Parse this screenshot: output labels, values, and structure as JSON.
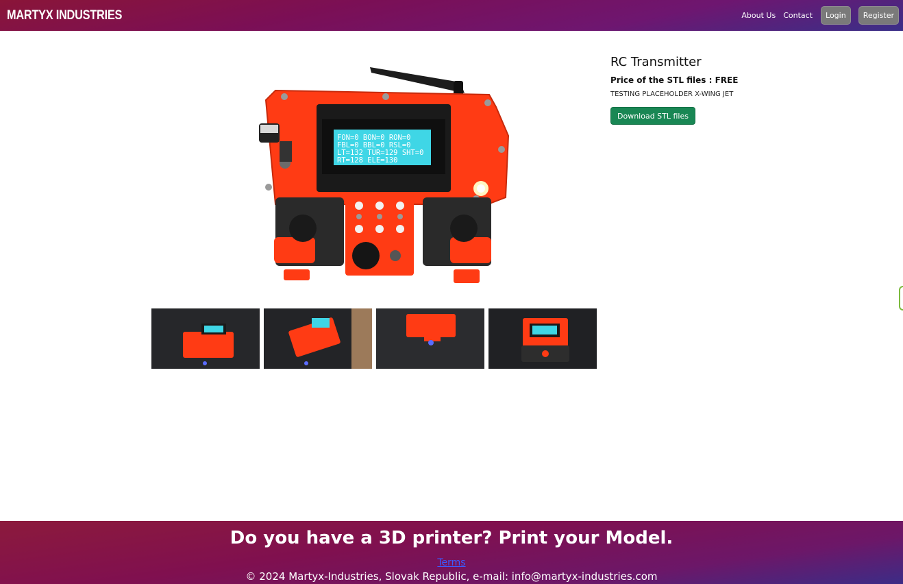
{
  "navbar": {
    "brand": "Martyx Industries",
    "links": {
      "about": "About Us",
      "contact": "Contact"
    },
    "buttons": {
      "login": "Login",
      "register": "Register"
    }
  },
  "product": {
    "title": "RC Transmitter",
    "price_line": "Price of the STL files : FREE",
    "description": "TESTING PLACEHOLDER X-WING JET",
    "download_label": "Download STL files",
    "lcd_lines": [
      "FON=0  BON=0  RON=0",
      "FBL=0  BBL=0  RSL=0",
      "LT=132 TUR=129 SHT=0",
      "RT=128 ELE=130"
    ],
    "accent_color": "#ff3b14",
    "thumbnail_count": 4
  },
  "footer": {
    "headline": "Do you have a 3D printer? Print your Model.",
    "terms_link": "Terms",
    "copyright": "© 2024 Martyx-Industries, Slovak Republic, e-mail: info@martyx-industries.com"
  },
  "colors": {
    "brand_gradient_start": "#8a1538",
    "brand_gradient_end": "#3a2f88",
    "download_button": "#198754",
    "nav_button": "#7a7a7a"
  }
}
